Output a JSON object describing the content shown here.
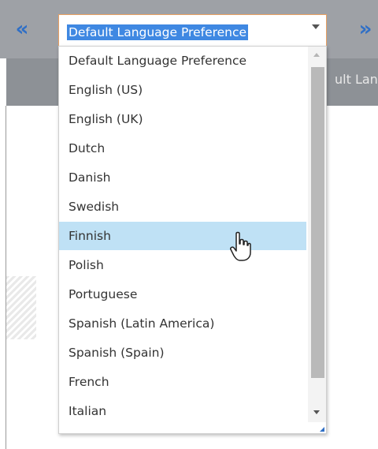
{
  "toolbar": {
    "prev_icon": "chevron-left-icon",
    "next_icon": "chevron-right-icon",
    "background_text": "ult Lan"
  },
  "language_select": {
    "selected_value": "Default Language Preference",
    "options": [
      {
        "label": "Default Language Preference"
      },
      {
        "label": "English (US)"
      },
      {
        "label": "English (UK)"
      },
      {
        "label": "Dutch"
      },
      {
        "label": "Danish"
      },
      {
        "label": "Swedish"
      },
      {
        "label": "Finnish",
        "hovered": true
      },
      {
        "label": "Polish"
      },
      {
        "label": "Portuguese"
      },
      {
        "label": "Spanish (Latin America)"
      },
      {
        "label": "Spanish (Spain)"
      },
      {
        "label": "French"
      },
      {
        "label": "Italian"
      }
    ]
  },
  "colors": {
    "accent": "#3f88e2",
    "hover": "#bfe1f5",
    "focus_border": "#e9a062"
  },
  "cursor": "hand-pointer-icon"
}
